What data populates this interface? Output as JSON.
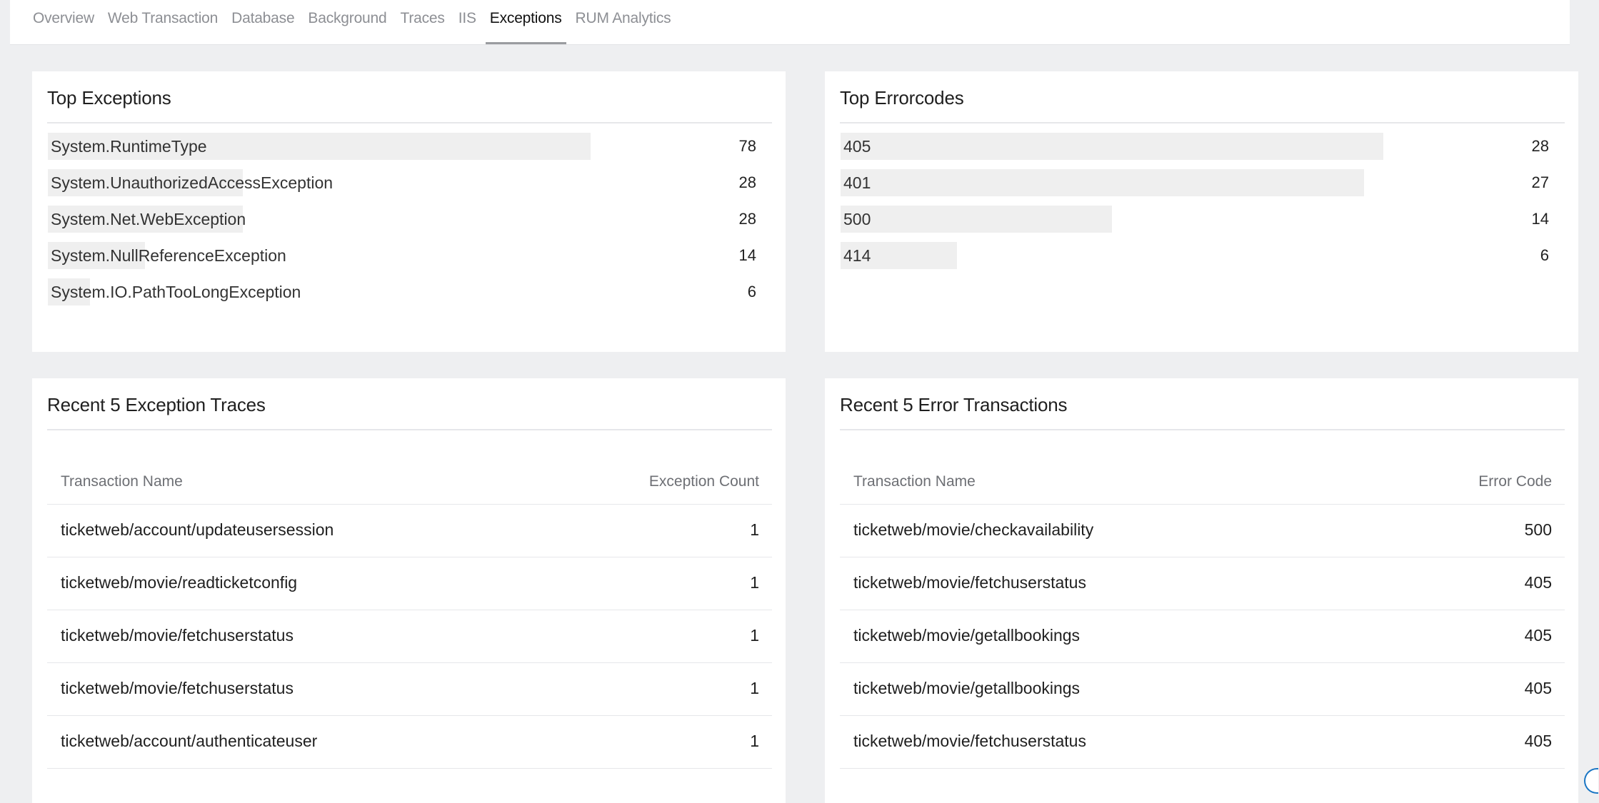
{
  "tabs": [
    {
      "label": "Overview"
    },
    {
      "label": "Web Transaction"
    },
    {
      "label": "Database"
    },
    {
      "label": "Background"
    },
    {
      "label": "Traces"
    },
    {
      "label": "IIS"
    },
    {
      "label": "Exceptions",
      "active": true
    },
    {
      "label": "RUM Analytics"
    }
  ],
  "top_exceptions": {
    "title": "Top Exceptions",
    "items": [
      {
        "label": "System.RuntimeType",
        "value": "78",
        "fraction": 1.0
      },
      {
        "label": "System.UnauthorizedAccessException",
        "value": "28",
        "fraction": 0.359
      },
      {
        "label": "System.Net.WebException",
        "value": "28",
        "fraction": 0.359
      },
      {
        "label": "System.NullReferenceException",
        "value": "14",
        "fraction": 0.179
      },
      {
        "label": "System.IO.PathTooLongException",
        "value": "6",
        "fraction": 0.077
      }
    ]
  },
  "top_errorcodes": {
    "title": "Top Errorcodes",
    "items": [
      {
        "label": "405",
        "value": "28",
        "fraction": 1.0
      },
      {
        "label": "401",
        "value": "27",
        "fraction": 0.964
      },
      {
        "label": "500",
        "value": "14",
        "fraction": 0.5
      },
      {
        "label": "414",
        "value": "6",
        "fraction": 0.214
      }
    ]
  },
  "recent_exception_traces": {
    "title": "Recent 5 Exception Traces",
    "columns": [
      "Transaction Name",
      "Exception Count"
    ],
    "rows": [
      [
        "ticketweb/account/updateusersession",
        "1"
      ],
      [
        "ticketweb/movie/readticketconfig",
        "1"
      ],
      [
        "ticketweb/movie/fetchuserstatus",
        "1"
      ],
      [
        "ticketweb/movie/fetchuserstatus",
        "1"
      ],
      [
        "ticketweb/account/authenticateuser",
        "1"
      ]
    ]
  },
  "recent_error_transactions": {
    "title": "Recent 5 Error Transactions",
    "columns": [
      "Transaction Name",
      "Error Code"
    ],
    "rows": [
      [
        "ticketweb/movie/checkavailability",
        "500"
      ],
      [
        "ticketweb/movie/fetchuserstatus",
        "405"
      ],
      [
        "ticketweb/movie/getallbookings",
        "405"
      ],
      [
        "ticketweb/movie/getallbookings",
        "405"
      ],
      [
        "ticketweb/movie/fetchuserstatus",
        "405"
      ]
    ]
  },
  "colors": {
    "bar_fill": "#efefef",
    "background": "#eeeff1",
    "tab_inactive": "#8d8f94",
    "tab_active": "#111111"
  }
}
